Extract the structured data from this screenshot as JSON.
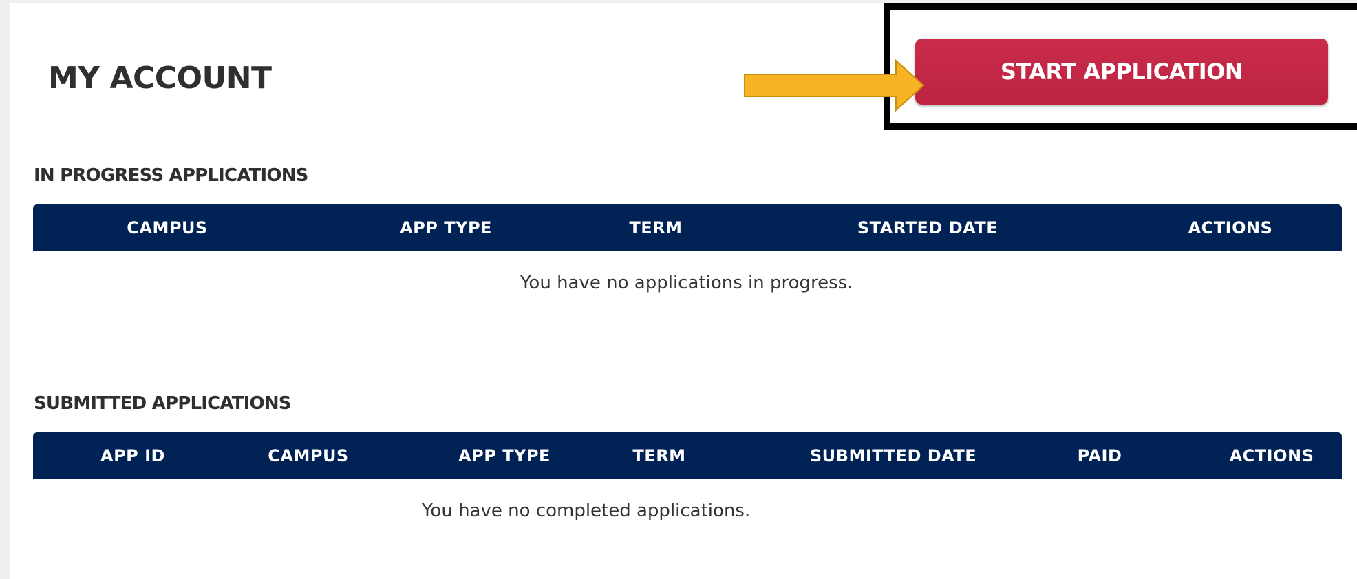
{
  "header": {
    "title": "MY ACCOUNT",
    "start_button_label": "START APPLICATION"
  },
  "in_progress": {
    "title": "IN PROGRESS APPLICATIONS",
    "columns": [
      "CAMPUS",
      "APP TYPE",
      "TERM",
      "STARTED DATE",
      "ACTIONS"
    ],
    "empty_message": "You have no applications in progress."
  },
  "submitted": {
    "title": "SUBMITTED APPLICATIONS",
    "columns": [
      "APP ID",
      "CAMPUS",
      "APP TYPE",
      "TERM",
      "SUBMITTED DATE",
      "PAID",
      "ACTIONS"
    ],
    "empty_message": "You have no completed applications."
  },
  "colors": {
    "table_header_bg": "#002255",
    "button_bg": "#c42847",
    "arrow_fill": "#f7b321",
    "highlight_border": "#000000"
  },
  "icons": {
    "callout_arrow": "arrow-right-icon"
  }
}
